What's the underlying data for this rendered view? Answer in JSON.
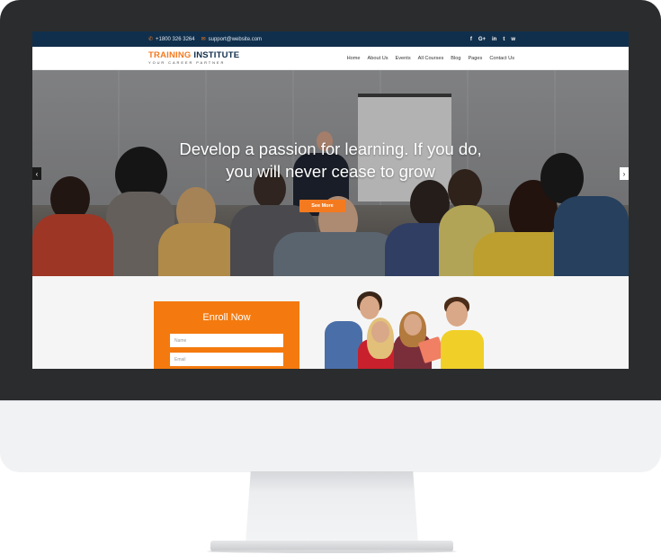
{
  "topbar": {
    "phone": "+1800 326 3264",
    "email": "support@website.com",
    "phone_icon": "phone-icon",
    "email_icon": "envelope-icon",
    "social": [
      "f",
      "G+",
      "in",
      "t",
      "w"
    ]
  },
  "brand": {
    "name_part1": "TRAINING",
    "name_part2": "INSTITUTE",
    "tagline": "YOUR CAREER PARTNER"
  },
  "nav": {
    "items": [
      "Home",
      "About Us",
      "Events",
      "All Courses",
      "Blog",
      "Pages",
      "Contact Us"
    ]
  },
  "hero": {
    "line1": "Develop a passion for learning. If you do,",
    "line2": "you will never cease to grow",
    "cta_label": "See More",
    "prev_label": "‹",
    "next_label": "›"
  },
  "enroll": {
    "title": "Enroll Now",
    "name_placeholder": "Name",
    "email_placeholder": "Email"
  },
  "colors": {
    "topbar_bg": "#102f4c",
    "accent": "#f47a20",
    "bezel": "#2b2c2e"
  }
}
